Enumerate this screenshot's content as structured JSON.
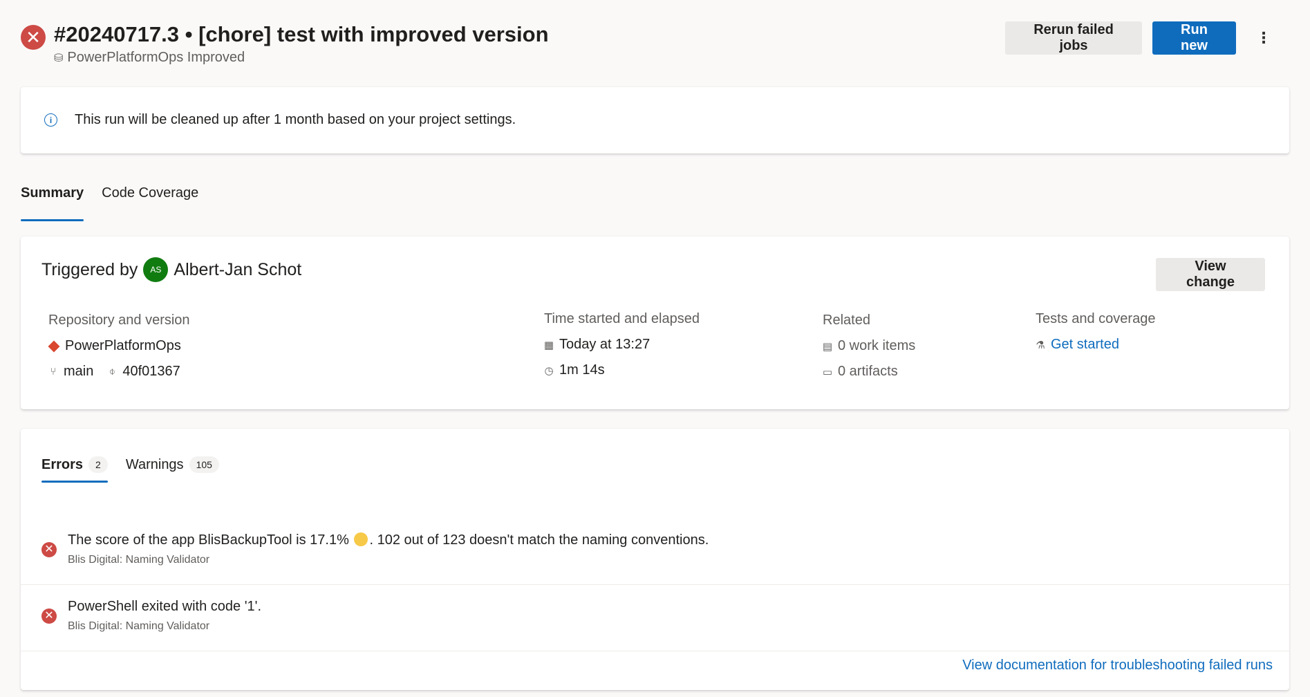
{
  "header": {
    "run_title": "#20240717.3 • [chore] test with improved version",
    "pipeline_name": "PowerPlatformOps Improved",
    "rerun_label": "Rerun failed jobs",
    "run_new_label": "Run new",
    "more_icon": "⋮"
  },
  "info_banner": {
    "text": "This run will be cleaned up after 1 month based on your project settings."
  },
  "tabs": [
    {
      "label": "Summary",
      "active": true
    },
    {
      "label": "Code Coverage",
      "active": false
    }
  ],
  "trigger": {
    "prefix": "Triggered by",
    "avatar_initials": "AS",
    "user_name": "Albert-Jan Schot",
    "view_change_label": "View change"
  },
  "details": {
    "repo": {
      "heading": "Repository and version",
      "repo_name": "PowerPlatformOps",
      "branch": "main",
      "commit": "40f01367"
    },
    "time": {
      "heading": "Time started and elapsed",
      "started": "Today at 13:27",
      "elapsed": "1m 14s"
    },
    "related": {
      "heading": "Related",
      "work_items": "0 work items",
      "artifacts": "0 artifacts"
    },
    "tests": {
      "heading": "Tests and coverage",
      "link": "Get started"
    }
  },
  "issues": {
    "tabs": [
      {
        "label": "Errors",
        "count": "2",
        "active": true
      },
      {
        "label": "Warnings",
        "count": "105",
        "active": false
      }
    ],
    "errors": [
      {
        "message_before": "The score of the app BlisBackupTool is 17.1%",
        "message_after": ". 102 out of 123 doesn't match the naming conventions.",
        "source": "Blis Digital: Naming Validator"
      },
      {
        "message_before": "PowerShell exited with code '1'.",
        "message_after": "",
        "source": "Blis Digital: Naming Validator"
      }
    ],
    "doc_link": "View documentation for troubleshooting failed runs"
  },
  "colors": {
    "accent": "#0f6cbd",
    "error": "#cd4a45",
    "avatar": "#107c10",
    "repo": "#d9472f"
  }
}
